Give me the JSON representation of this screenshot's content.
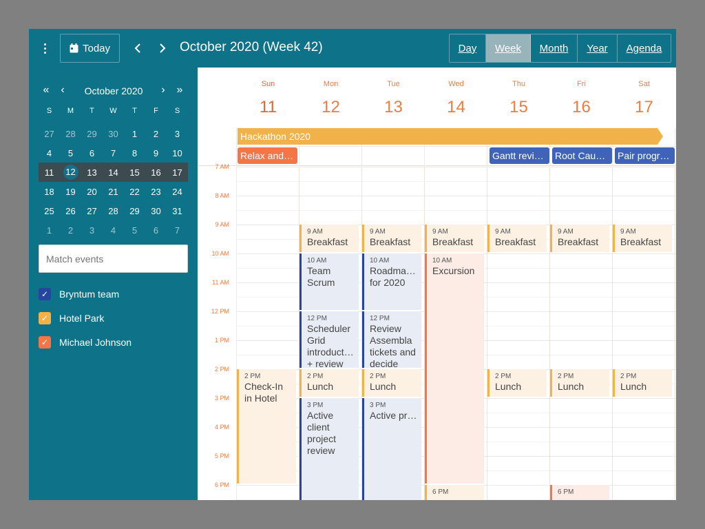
{
  "toolbar": {
    "today_label": "Today",
    "title": "October 2020 (Week 42)",
    "views": [
      {
        "label": "Day",
        "active": false
      },
      {
        "label": "Week",
        "active": true
      },
      {
        "label": "Month",
        "active": false
      },
      {
        "label": "Year",
        "active": false
      },
      {
        "label": "Agenda",
        "active": false
      }
    ]
  },
  "sidebar": {
    "mini_calendar": {
      "title": "October 2020",
      "day_names": [
        "S",
        "M",
        "T",
        "W",
        "T",
        "F",
        "S"
      ],
      "weeks": [
        [
          "27",
          "28",
          "29",
          "30",
          "1",
          "2",
          "3"
        ],
        [
          "4",
          "5",
          "6",
          "7",
          "8",
          "9",
          "10"
        ],
        [
          "11",
          "12",
          "13",
          "14",
          "15",
          "16",
          "17"
        ],
        [
          "18",
          "19",
          "20",
          "21",
          "22",
          "23",
          "24"
        ],
        [
          "25",
          "26",
          "27",
          "28",
          "29",
          "30",
          "31"
        ],
        [
          "1",
          "2",
          "3",
          "4",
          "5",
          "6",
          "7"
        ]
      ],
      "selected_week_index": 2,
      "today": "12"
    },
    "search": {
      "placeholder": "Match events"
    },
    "resources": [
      {
        "label": "Bryntum team",
        "color": "#2545a0"
      },
      {
        "label": "Hotel Park",
        "color": "#f2b24a"
      },
      {
        "label": "Michael Johnson",
        "color": "#f47545"
      }
    ]
  },
  "calendar": {
    "days": [
      {
        "dow": "Sun",
        "num": "11"
      },
      {
        "dow": "Mon",
        "num": "12"
      },
      {
        "dow": "Tue",
        "num": "13"
      },
      {
        "dow": "Wed",
        "num": "14"
      },
      {
        "dow": "Thu",
        "num": "15"
      },
      {
        "dow": "Fri",
        "num": "16"
      },
      {
        "dow": "Sat",
        "num": "17"
      }
    ],
    "all_day": {
      "hackathon": "Hackathon 2020",
      "relax": "Relax and…",
      "gantt": "Gantt revi…",
      "root_cause": "Root Cau…",
      "pair": "Pair progr…"
    },
    "hours": [
      "7 AM",
      "8 AM",
      "9 AM",
      "10 AM",
      "11 AM",
      "12 PM",
      "1 PM",
      "2 PM",
      "3 PM",
      "4 PM",
      "5 PM",
      "6 PM"
    ],
    "events": {
      "breakfast": {
        "time": "9 AM",
        "name": "Breakfast"
      },
      "team_scrum": {
        "time": "10 AM",
        "name": "Team Scrum"
      },
      "roadmap": {
        "time": "10 AM",
        "name": "Roadma… for 2020"
      },
      "excursion": {
        "time": "10 AM",
        "name": "Excursion"
      },
      "scheduler": {
        "time": "12 PM",
        "name": "Scheduler Grid introduct… + review"
      },
      "review_assembla": {
        "time": "12 PM",
        "name": "Review Assembla tickets and decide"
      },
      "checkin": {
        "time": "2 PM",
        "name": "Check-In in Hotel"
      },
      "lunch": {
        "time": "2 PM",
        "name": "Lunch"
      },
      "active_client": {
        "time": "3 PM",
        "name": "Active client project review"
      },
      "active_program": {
        "time": "3 PM",
        "name": "Active program…"
      },
      "six_pm": {
        "time": "6 PM",
        "name": ""
      }
    }
  },
  "colors": {
    "app_bg": "#0e7288",
    "accent_orange": "#f27a3d",
    "hotel_park": "#f2b24a",
    "bryntum_team": "#2545a0",
    "michael_johnson": "#f47545"
  }
}
